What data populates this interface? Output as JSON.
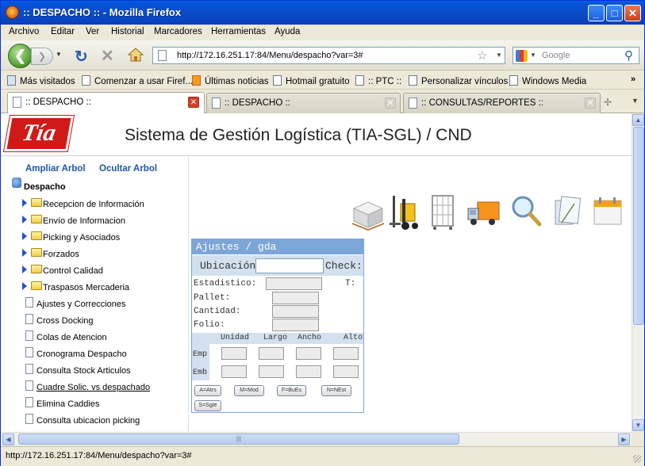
{
  "window": {
    "title": ":: DESPACHO :: - Mozilla Firefox",
    "minimize_icon": "minimize-icon",
    "maximize_icon": "maximize-icon",
    "close_icon": "close-icon"
  },
  "menubar": {
    "items": [
      "Archivo",
      "Editar",
      "Ver",
      "Historial",
      "Marcadores",
      "Herramientas",
      "Ayuda"
    ]
  },
  "navbar": {
    "url": "http://172.16.251.17:84/Menu/despacho?var=3#",
    "search_placeholder": "Google"
  },
  "bookmarks": {
    "items": [
      "Más visitados",
      "Comenzar a usar Firef...",
      "Últimas noticias",
      "Hotmail gratuito",
      ":: PTC ::",
      "Personalizar vínculos",
      "Windows Media"
    ],
    "more": "»"
  },
  "tabs": [
    {
      "label": ":: DESPACHO ::",
      "active": true
    },
    {
      "label": ":: DESPACHO ::",
      "active": false
    },
    {
      "label": ":: CONSULTAS/REPORTES ::",
      "active": false
    }
  ],
  "page": {
    "logo_text": "Tía",
    "system_title": "Sistema de Gestión Logística (TIA-SGL) / CND",
    "sidebar": {
      "expand_link": "Ampliar Arbol",
      "hide_link": "Ocultar Arbol",
      "root": "Despacho",
      "folders": [
        "Recepcion de Información",
        "Envío de Informacion",
        "Picking y Asociados",
        "Forzados",
        "Control Calidad",
        "Traspasos Mercaderia"
      ],
      "items": [
        "Ajustes y Correcciones",
        "Cross Docking",
        "Colas de Atencion",
        "Cronograma Despacho",
        "Consulta Stock Articulos",
        "Cuadre Solic. vs despachado",
        "Elimina Caddies",
        "Consulta ubicacion picking"
      ]
    },
    "toolbar_icons": [
      "pallet-icon",
      "forklift-icon",
      "cage-cart-icon",
      "delivery-truck-icon",
      "magnifier-icon",
      "documents-icon",
      "calendar-icon"
    ],
    "panel": {
      "title": "Ajustes / gda",
      "ubicacion_label": "Ubicación:",
      "ubicacion_value": "",
      "check_label": "Check:",
      "estadistico_label": "Estadistico:",
      "t_label": "T:",
      "pallet_label": "Pallet:",
      "cantidad_label": "Cantidad:",
      "folio_label": "Folio:",
      "dims_headers": [
        "Unidad",
        "Largo",
        "Ancho",
        "Alto"
      ],
      "row_emp": "Emp",
      "row_emb": "Emb",
      "buttons": [
        "A=Atrs",
        "M=Mod",
        "F=BuEs",
        "N=NEst",
        "S=Sgte"
      ]
    }
  },
  "status": {
    "text": "http://172.16.251.17:84/Menu/despacho?var=3#"
  },
  "colors": {
    "titlebar": "#0A4CC7",
    "logo_red": "#d01a18",
    "link_blue": "#1f56a8",
    "panel_header": "#7da6d8",
    "panel_bg": "#d3e0ef"
  }
}
